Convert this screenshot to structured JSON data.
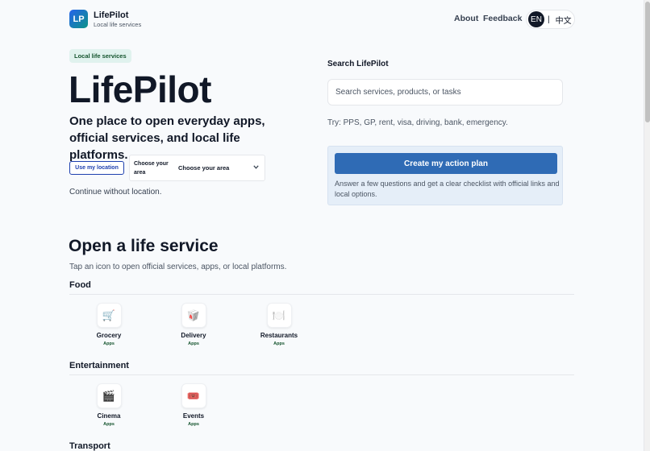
{
  "header": {
    "logo_text": "LP",
    "app_name": "LifePilot",
    "tagline": "Local life services",
    "nav": {
      "about": "About",
      "feedback": "Feedback"
    },
    "language": {
      "current": "EN",
      "separator": "|",
      "other": "中文"
    }
  },
  "hero": {
    "badge": "Local life services",
    "title": "LifePilot",
    "subtitle": "One place to open everyday apps, official services, and local life platforms.",
    "use_location_label": "Use my location",
    "area_label": "Choose your area",
    "area_selected": "Choose your area",
    "no_location_text": "Continue without location."
  },
  "search": {
    "label": "Search LifePilot",
    "placeholder": "Search services, products, or tasks",
    "try_text": "Try: PPS, GP, rent, visa, driving, bank, emergency."
  },
  "action_plan": {
    "button_label": "Create my action plan",
    "description": "Answer a few questions and get a clear checklist with official links and local options."
  },
  "services": {
    "title": "Open a life service",
    "subtitle": "Tap an icon to open official services, apps, or local platforms.",
    "categories": [
      {
        "name": "Food",
        "tiles": [
          {
            "name": "Grocery",
            "badge": "Apps",
            "icon": "🛒"
          },
          {
            "name": "Delivery",
            "badge": "Apps",
            "icon": "🥡"
          },
          {
            "name": "Restaurants",
            "badge": "Apps",
            "icon": "🍽️"
          }
        ]
      },
      {
        "name": "Entertainment",
        "tiles": [
          {
            "name": "Cinema",
            "badge": "Apps",
            "icon": "🎬"
          },
          {
            "name": "Events",
            "badge": "Apps",
            "icon": "🎟️"
          }
        ]
      },
      {
        "name": "Transport",
        "tiles": []
      }
    ]
  }
}
